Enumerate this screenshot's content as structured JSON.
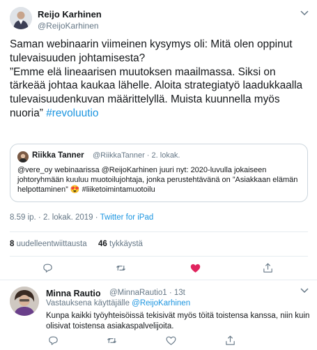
{
  "main_tweet": {
    "author_name": "Reijo Karhinen",
    "author_handle": "@ReijoKarhinen",
    "text": "Saman webinaarin viimeinen kysymys oli: Mitä olen oppinut tulevaisuuden johtamisesta?\n”Emme elä lineaarisen muutoksen maailmassa. Siksi on tärkeää johtaa kaukaa lähelle. Aloita strategiatyö laadukkaalla tulevaisuudenkuvan määrittelyllä. Muista kuunnella myös nuoria” ",
    "hashtag": "#revoluutio",
    "timestamp": "8.59 ip. · 2. lokak. 2019 · ",
    "source": "Twitter for iPad",
    "retweets_count": "8",
    "retweets_label": " uudelleentwiittausta",
    "likes_count": "46",
    "likes_label": " tykkäystä"
  },
  "quoted_tweet": {
    "author_name": "Riikka Tanner",
    "meta": "@RiikkaTanner · 2. lokak.",
    "text": "@vere_oy  webinaarissa @ReijoKarhinen juuri nyt: 2020-luvulla jokaiseen johtoryhmään kuuluu muotoilujohtaja, jonka perustehtävänä on ”Asiakkaan elämän helpottaminen” 😍 #liiketoimintamuotoilu"
  },
  "reply_tweet": {
    "author_name": "Minna Rautio",
    "meta": "@MinnaRautio1 · 13t",
    "replying_prefix": "Vastauksena käyttäjälle ",
    "replying_to": "@ReijoKarhinen",
    "text": "Kunpa kaikki työyhteisöissä tekisivät myös töitä toistensa kanssa, niin kuin olisivat toistensa asiakaspalvelijoita."
  },
  "colors": {
    "accent": "#1b95e0",
    "like_red": "#e0245e",
    "muted": "#657786"
  },
  "icons": [
    "chevron-down-icon",
    "reply-icon",
    "retweet-icon",
    "like-icon",
    "share-icon"
  ]
}
